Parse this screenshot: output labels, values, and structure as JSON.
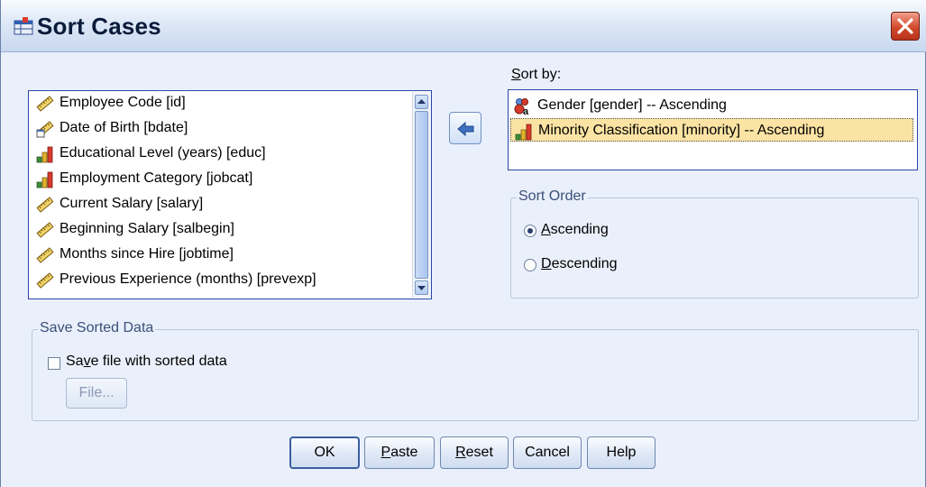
{
  "window": {
    "title": "Sort Cases"
  },
  "variables": [
    {
      "label": "Employee Code [id]",
      "icon": "scale-icon"
    },
    {
      "label": "Date of Birth [bdate]",
      "icon": "date-scale-icon"
    },
    {
      "label": "Educational Level (years) [educ]",
      "icon": "ordinal-icon"
    },
    {
      "label": "Employment Category [jobcat]",
      "icon": "ordinal-icon"
    },
    {
      "label": "Current Salary [salary]",
      "icon": "scale-icon"
    },
    {
      "label": "Beginning Salary [salbegin]",
      "icon": "scale-icon"
    },
    {
      "label": "Months since Hire [jobtime]",
      "icon": "scale-icon"
    },
    {
      "label": "Previous Experience (months) [prevexp]",
      "icon": "scale-icon"
    }
  ],
  "sort_by": {
    "label_prefix": "S",
    "label_rest": "ort by:",
    "items": [
      {
        "label": "Gender [gender] -- Ascending",
        "icon": "nominal-icon",
        "selected": false
      },
      {
        "label": "Minority Classification [minority] -- Ascending",
        "icon": "ordinal-icon",
        "selected": true
      }
    ]
  },
  "sort_order": {
    "legend": "Sort Order",
    "ascending": {
      "mn": "A",
      "rest": "scending",
      "checked": true
    },
    "descending": {
      "mn": "D",
      "rest": "escending",
      "checked": false
    }
  },
  "save_sorted": {
    "legend": "Save Sorted Data",
    "checkbox_pre": "Sa",
    "checkbox_mn": "v",
    "checkbox_post": "e file with sorted data",
    "checked": false,
    "file_button": "File..."
  },
  "buttons": {
    "ok": "OK",
    "paste_mn": "P",
    "paste_rest": "aste",
    "reset_mn": "R",
    "reset_rest": "eset",
    "cancel": "Cancel",
    "help": "Help"
  },
  "colors": {
    "selection": "#fbe3a4",
    "listbox_border": "#2a45a8",
    "dialog_bg": "#eaf0fb"
  }
}
